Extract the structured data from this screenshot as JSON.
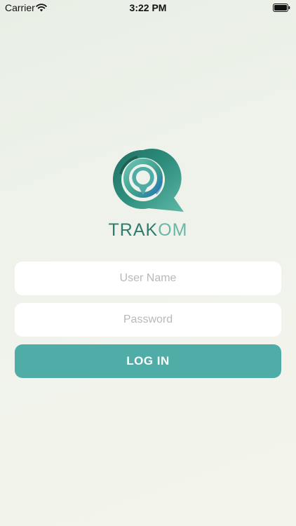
{
  "status_bar": {
    "carrier": "Carrier",
    "time": "3:22 PM",
    "wifi_icon": "wifi-icon",
    "battery_icon": "battery-full-icon"
  },
  "logo": {
    "icon": "chat-bubble-location-icon",
    "text_part1": "TRAK",
    "text_part2": "OM"
  },
  "form": {
    "username_placeholder": "User Name",
    "username_value": "",
    "password_placeholder": "Password",
    "password_value": "",
    "login_label": "LOG IN"
  },
  "colors": {
    "accent": "#4faca6",
    "logo_dark": "#2c7d70",
    "logo_light": "#68b7a9",
    "background": "#eef2ea"
  }
}
